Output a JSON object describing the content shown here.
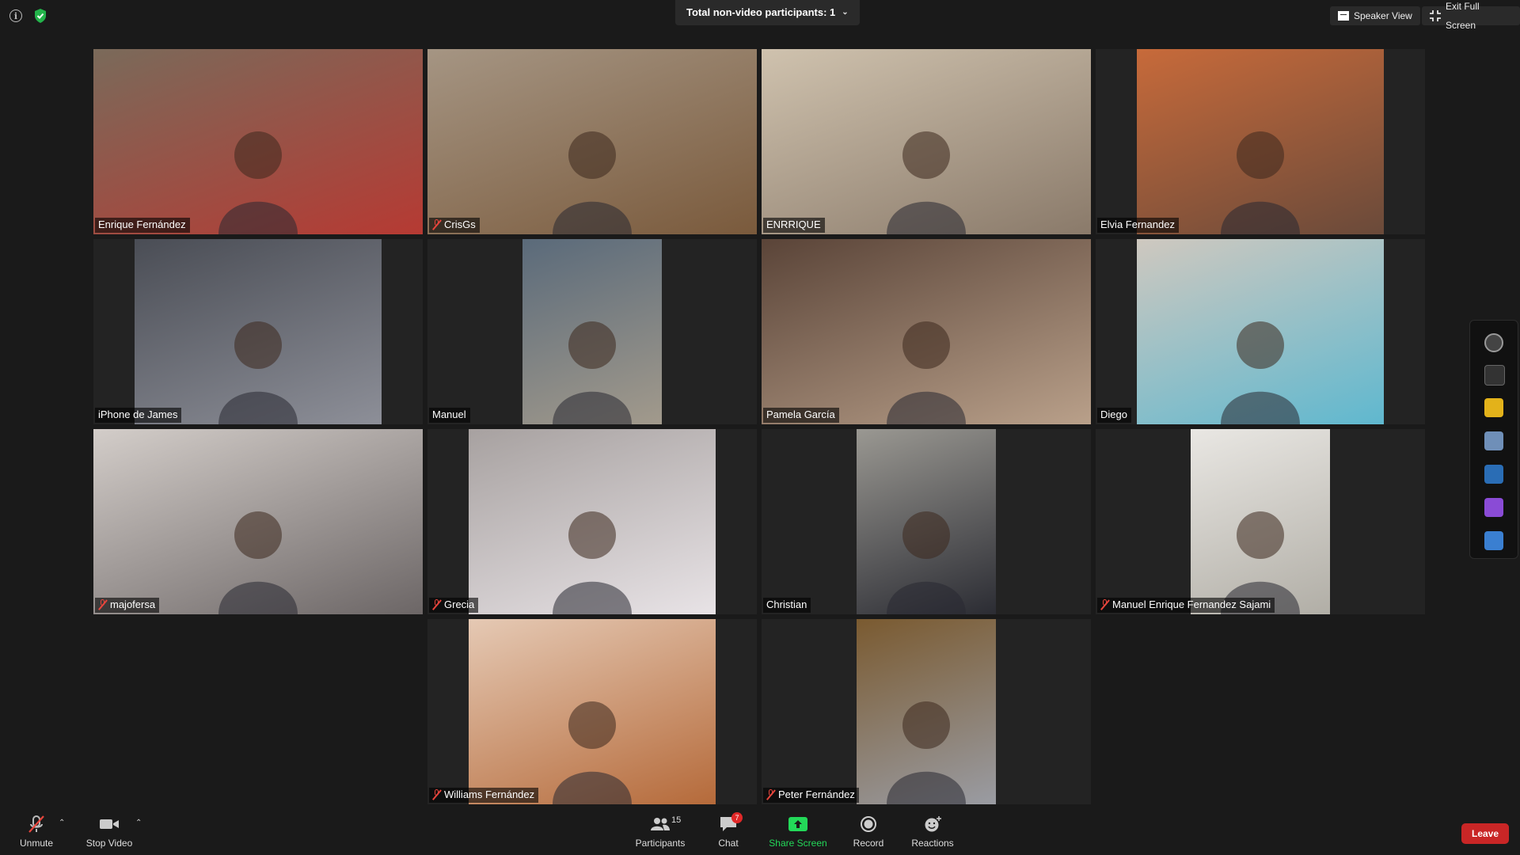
{
  "topbar": {
    "nonvideo_label": "Total non-video participants: 1",
    "speaker_view": "Speaker View",
    "exit_full_screen": "Exit Full Screen"
  },
  "participants": [
    {
      "name": "Enrique Fernández",
      "muted": false,
      "active": true
    },
    {
      "name": "CrisGs",
      "muted": true
    },
    {
      "name": "ENRRIQUE",
      "muted": false
    },
    {
      "name": "Elvia Fernandez",
      "muted": false
    },
    {
      "name": "iPhone de James",
      "muted": false
    },
    {
      "name": "Manuel",
      "muted": false
    },
    {
      "name": "Pamela García",
      "muted": false
    },
    {
      "name": "Diego",
      "muted": false
    },
    {
      "name": "majofersa",
      "muted": true
    },
    {
      "name": "Grecia",
      "muted": true
    },
    {
      "name": "Christian",
      "muted": false
    },
    {
      "name": "Manuel Enrique Fernandez Sajami",
      "muted": true
    },
    {
      "name": "Williams Fernández",
      "muted": true
    },
    {
      "name": "Peter Fernández",
      "muted": true
    }
  ],
  "toolbar": {
    "unmute": "Unmute",
    "stop_video": "Stop Video",
    "participants_label": "Participants",
    "participants_count": "15",
    "chat_label": "Chat",
    "chat_badge": "7",
    "share_screen": "Share Screen",
    "record": "Record",
    "reactions": "Reactions",
    "leave": "Leave"
  },
  "colors": {
    "active_speaker": "#d4e34a",
    "share_green": "#23d959",
    "leave_red": "#c92626",
    "muted_red": "#e8453c"
  }
}
